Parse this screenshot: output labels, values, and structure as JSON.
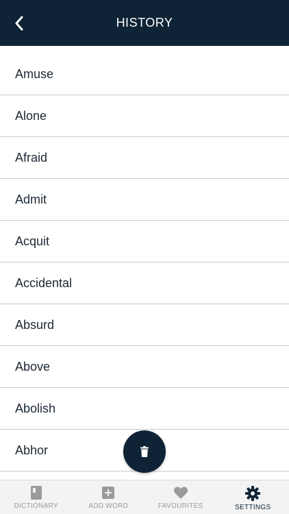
{
  "header": {
    "title": "HISTORY",
    "back_icon": "chevron-left-icon"
  },
  "history": {
    "items": [
      "Amuse",
      "Alone",
      "Afraid",
      "Admit",
      "Acquit",
      "Accidental",
      "Absurd",
      "Above",
      "Abolish",
      "Abhor"
    ]
  },
  "fab": {
    "icon": "trash-icon"
  },
  "tabbar": {
    "tabs": [
      {
        "label": "DICTIONARY",
        "icon": "book-icon",
        "active": false
      },
      {
        "label": "ADD WORD",
        "icon": "plus-square-icon",
        "active": false
      },
      {
        "label": "FAVOURITES",
        "icon": "heart-icon",
        "active": false
      },
      {
        "label": "SETTINGS",
        "icon": "gear-icon",
        "active": true
      }
    ]
  },
  "colors": {
    "primary": "#0f2336",
    "inactive": "#9a9a9a",
    "divider": "#c9c9c9",
    "tabbar_bg": "#f3f3f3"
  }
}
